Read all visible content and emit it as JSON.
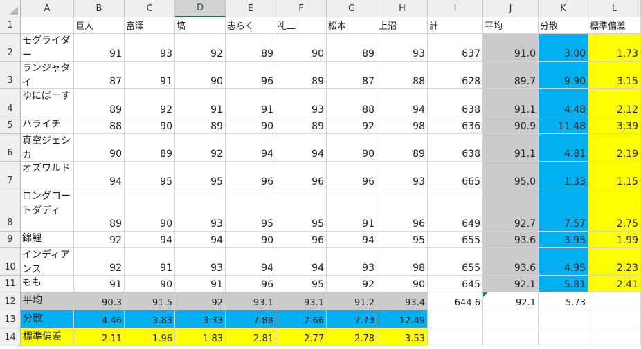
{
  "columns": [
    "A",
    "B",
    "C",
    "D",
    "E",
    "F",
    "G",
    "H",
    "I",
    "J",
    "K",
    "L"
  ],
  "selected_column": "D",
  "rows": [
    "1",
    "2",
    "3",
    "4",
    "5",
    "6",
    "7",
    "8",
    "9",
    "10",
    "11",
    "12",
    "13",
    "14"
  ],
  "header_row": [
    "",
    "巨人",
    "富澤",
    "塙",
    "志らく",
    "礼二",
    "松本",
    "上沼",
    "計",
    "平均",
    "分散",
    "標準偏差"
  ],
  "contestants": [
    {
      "name": "モグライダー",
      "scores": [
        "91",
        "93",
        "92",
        "89",
        "90",
        "89",
        "93"
      ],
      "total": "637",
      "mean": "91.0",
      "variance": "3.00",
      "stdev": "1.73"
    },
    {
      "name": "ランジャタイ",
      "scores": [
        "87",
        "91",
        "90",
        "96",
        "89",
        "87",
        "88"
      ],
      "total": "628",
      "mean": "89.7",
      "variance": "9.90",
      "stdev": "3.15"
    },
    {
      "name": "ゆにばーす",
      "scores": [
        "89",
        "92",
        "91",
        "91",
        "93",
        "88",
        "94"
      ],
      "total": "638",
      "mean": "91.1",
      "variance": "4.48",
      "stdev": "2.12"
    },
    {
      "name": "ハライチ",
      "scores": [
        "88",
        "90",
        "89",
        "90",
        "89",
        "92",
        "98"
      ],
      "total": "636",
      "mean": "90.9",
      "variance": "11.48",
      "stdev": "3.39"
    },
    {
      "name": "真空ジェシカ",
      "scores": [
        "90",
        "89",
        "92",
        "94",
        "94",
        "90",
        "89"
      ],
      "total": "638",
      "mean": "91.1",
      "variance": "4.81",
      "stdev": "2.19"
    },
    {
      "name": "オズワルド",
      "scores": [
        "94",
        "95",
        "95",
        "96",
        "96",
        "96",
        "93"
      ],
      "total": "665",
      "mean": "95.0",
      "variance": "1.33",
      "stdev": "1.15"
    },
    {
      "name": "ロングコートダディ",
      "scores": [
        "89",
        "90",
        "93",
        "95",
        "95",
        "91",
        "96"
      ],
      "total": "649",
      "mean": "92.7",
      "variance": "7.57",
      "stdev": "2.75"
    },
    {
      "name": "錦鯉",
      "scores": [
        "92",
        "94",
        "94",
        "90",
        "96",
        "94",
        "95"
      ],
      "total": "655",
      "mean": "93.6",
      "variance": "3.95",
      "stdev": "1.99"
    },
    {
      "name": "インディアンス",
      "scores": [
        "92",
        "91",
        "93",
        "94",
        "94",
        "93",
        "98"
      ],
      "total": "655",
      "mean": "93.6",
      "variance": "4.95",
      "stdev": "2.23"
    },
    {
      "name": "もも",
      "scores": [
        "91",
        "90",
        "91",
        "96",
        "95",
        "92",
        "90"
      ],
      "total": "645",
      "mean": "92.1",
      "variance": "5.81",
      "stdev": "2.41"
    }
  ],
  "summary": {
    "mean": {
      "label": "平均",
      "values": [
        "90.3",
        "91.5",
        "92",
        "93.1",
        "93.1",
        "91.2",
        "93.4"
      ],
      "total": "644.6",
      "mean": "92.1",
      "variance": "5.73"
    },
    "variance": {
      "label": "分散",
      "values": [
        "4.46",
        "3.83",
        "3.33",
        "7.88",
        "7.66",
        "7.73",
        "12.49"
      ]
    },
    "stdev": {
      "label": "標準偏差",
      "values": [
        "2.11",
        "1.96",
        "1.83",
        "2.81",
        "2.77",
        "2.78",
        "3.53"
      ]
    }
  },
  "colors": {
    "mean_fill": "#cbcbcb",
    "variance_fill": "#00b0f0",
    "stdev_fill": "#ffff00",
    "selected_header_accent": "#217346"
  }
}
